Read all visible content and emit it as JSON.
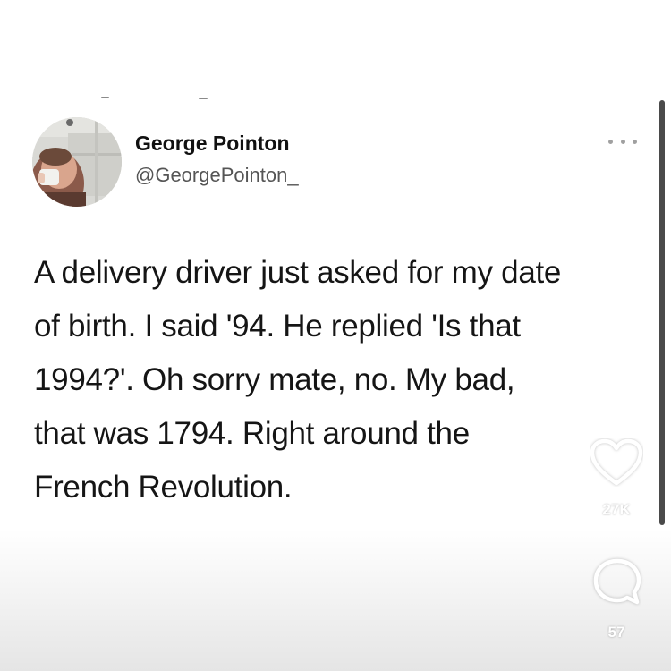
{
  "tweet": {
    "author": {
      "name": "George Pointon",
      "handle": "@GeorgePointon_"
    },
    "text_lines": [
      "A delivery driver just asked for my date",
      "of birth. I said '94. He replied 'Is that",
      "1994?'. Oh sorry mate, no. My bad,",
      "that was 1794. Right around the",
      "French Revolution."
    ],
    "more_icon": "more-horizontal-icon"
  },
  "reactions": {
    "like_icon": "heart-icon",
    "likes": "27K",
    "comment_icon": "comment-icon",
    "comments": "57"
  },
  "colors": {
    "text": "#151515",
    "handle": "#555555",
    "scrollbar": "#4a4a4a",
    "overlay_icon": "#ffffff"
  }
}
